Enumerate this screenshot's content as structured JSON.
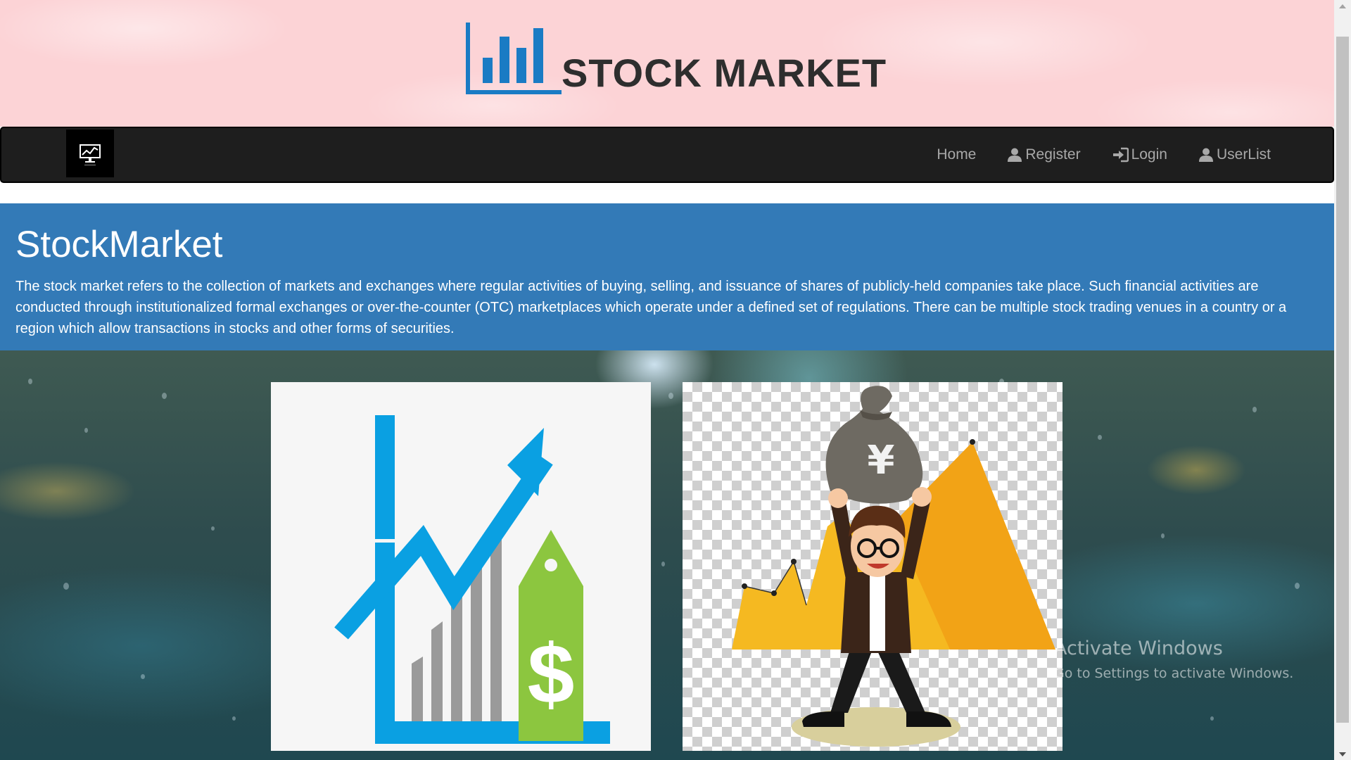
{
  "header": {
    "title": "STOCK MARKET",
    "logo_icon": "bar-chart-icon",
    "brand_color": "#1a7bc4"
  },
  "navbar": {
    "logo_icon": "monitor-chart-icon",
    "items": [
      {
        "label": "Home",
        "icon": ""
      },
      {
        "label": "Register",
        "icon": "user-icon"
      },
      {
        "label": "Login",
        "icon": "login-icon"
      },
      {
        "label": "UserList",
        "icon": "user-icon"
      }
    ]
  },
  "jumbotron": {
    "title": "StockMarket",
    "text": "The stock market refers to the collection of markets and exchanges where regular activities of buying, selling, and issuance of shares of publicly-held companies take place. Such financial activities are conducted through institutionalized formal exchanges or over-the-counter (OTC) marketplaces which operate under a defined set of regulations. There can be multiple stock trading venues in a country or a region which allow transactions in stocks and other forms of securities.",
    "background": "#337ab7"
  },
  "images": [
    {
      "icon": "growth-chart-dollar-tag-icon"
    },
    {
      "icon": "man-lifting-money-bag-icon"
    }
  ],
  "watermark": {
    "title": "Activate Windows",
    "subtitle": "Go to Settings to activate Windows."
  }
}
